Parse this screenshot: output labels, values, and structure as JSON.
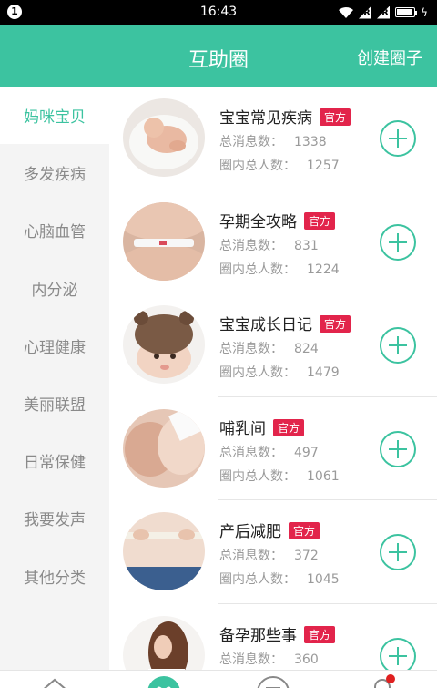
{
  "status_bar": {
    "notification": "1",
    "time": "16:43",
    "sim1": "R",
    "sim2": "R"
  },
  "header": {
    "title": "互助圈",
    "create_label": "创建圈子"
  },
  "sidebar": {
    "items": [
      {
        "label": "妈咪宝贝",
        "active": true
      },
      {
        "label": "多发疾病"
      },
      {
        "label": "心脑血管"
      },
      {
        "label": "内分泌"
      },
      {
        "label": "心理健康"
      },
      {
        "label": "美丽联盟"
      },
      {
        "label": "日常保健"
      },
      {
        "label": "我要发声"
      },
      {
        "label": "其他分类"
      }
    ]
  },
  "list": {
    "msg_label": "总消息数：",
    "member_label": "圈内总人数：",
    "groups": [
      {
        "name": "宝宝常见疾病",
        "badge": "官方",
        "messages": "1338",
        "members": "1257",
        "image": "baby-wrapped"
      },
      {
        "name": "孕期全攻略",
        "badge": "官方",
        "messages": "831",
        "members": "1224",
        "image": "pregnancy-test"
      },
      {
        "name": "宝宝成长日记",
        "badge": "官方",
        "messages": "824",
        "members": "1479",
        "image": "baby-hat"
      },
      {
        "name": "哺乳间",
        "badge": "官方",
        "messages": "497",
        "members": "1061",
        "image": "breastfeeding"
      },
      {
        "name": "产后减肥",
        "badge": "官方",
        "messages": "372",
        "members": "1045",
        "image": "waist-measure"
      },
      {
        "name": "备孕那些事",
        "badge": "官方",
        "messages": "360",
        "members": "",
        "image": "woman-portrait"
      }
    ]
  },
  "colors": {
    "accent": "#3cc3a0",
    "badge": "#e2244b",
    "status_bar": "#000000"
  },
  "tab_bar": {
    "tabs": [
      {
        "icon": "home-icon"
      },
      {
        "icon": "heart-icon",
        "active": true
      },
      {
        "icon": "menu-icon"
      },
      {
        "icon": "profile-icon",
        "has_dot": true
      }
    ]
  }
}
